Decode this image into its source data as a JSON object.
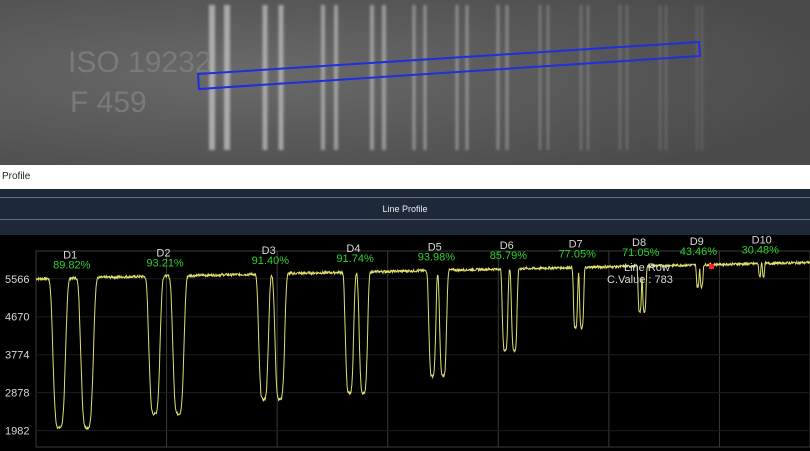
{
  "window": {
    "title": "Profile"
  },
  "panel": {
    "title": "Line Profile"
  },
  "image": {
    "plate_text_line1": "ISO 19232",
    "plate_text_line2": "F 459"
  },
  "colors": {
    "roi": "#1f2fe0",
    "profile": "#e0e070",
    "percent": "#2ed12e",
    "grid": "#3a3a3a",
    "marker": "#ff2020"
  },
  "overlay": {
    "text_line1": "Line Row",
    "text_line2": "C.Value : 783"
  },
  "chart_data": {
    "type": "line",
    "yticks": [
      "5566",
      "4670",
      "3774",
      "2878",
      "1982"
    ],
    "ytick_values": [
      5566,
      4670,
      3774,
      2878,
      1982
    ],
    "ylim": [
      1500,
      6600
    ],
    "xlim": [
      0,
      1000
    ],
    "baseline": {
      "x": [
        0,
        1000
      ],
      "y": [
        5566,
        5950
      ]
    },
    "dips": [
      {
        "label": "D1",
        "percent": "89.82%",
        "centers": [
          30,
          66
        ],
        "width": 9,
        "min": 2050
      },
      {
        "label": "D2",
        "percent": "93.21%",
        "centers": [
          153,
          184
        ],
        "width": 8,
        "min": 2380
      },
      {
        "label": "D3",
        "percent": "91.40%",
        "centers": [
          294,
          315
        ],
        "width": 7,
        "min": 2720
      },
      {
        "label": "D4",
        "percent": "91.74%",
        "centers": [
          405,
          423
        ],
        "width": 6,
        "min": 2870
      },
      {
        "label": "D5",
        "percent": "93.98%",
        "centers": [
          512,
          526
        ],
        "width": 5,
        "min": 3270
      },
      {
        "label": "D6",
        "percent": "85.79%",
        "centers": [
          606,
          618
        ],
        "width": 4,
        "min": 3870
      },
      {
        "label": "D7",
        "percent": "77.05%",
        "centers": [
          697,
          705
        ],
        "width": 3,
        "min": 4400
      },
      {
        "label": "D8",
        "percent": "71.05%",
        "centers": [
          780,
          786
        ],
        "width": 2.5,
        "min": 4800
      },
      {
        "label": "D9",
        "percent": "43.46%",
        "centers": [
          855,
          860
        ],
        "width": 2,
        "min": 5380
      },
      {
        "label": "D10",
        "percent": "30.48%",
        "centers": [
          935,
          940
        ],
        "width": 1.5,
        "min": 5620
      }
    ]
  }
}
